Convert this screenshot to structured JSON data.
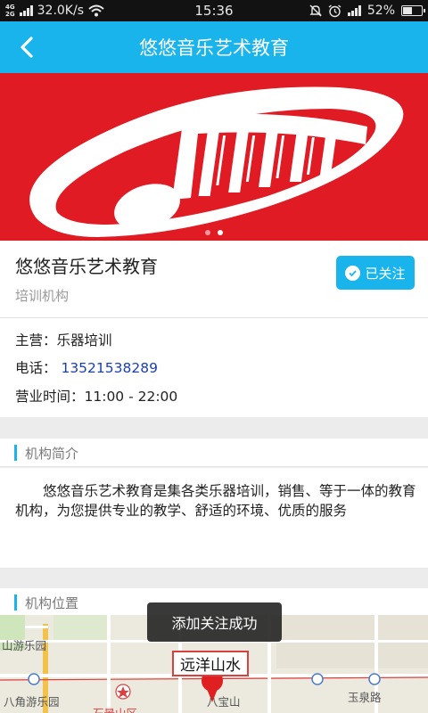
{
  "status_bar": {
    "network_top": "4G",
    "network_bottom": "2G",
    "speed": "32.0K/s",
    "time": "15:36",
    "battery_percent": "52%",
    "battery_level": 0.52,
    "icons": [
      "signal-icon",
      "wifi-icon",
      "mute-icon",
      "alarm-icon",
      "signal-icon",
      "battery-icon"
    ]
  },
  "app_bar": {
    "title": "悠悠音乐艺术教育",
    "back_icon": "back-arrow-icon"
  },
  "banner": {
    "slide_count": 2,
    "active_slide": 2,
    "background_color": "#e01b24"
  },
  "header": {
    "name": "悠悠音乐艺术教育",
    "category": "培训机构",
    "follow_label": "已关注"
  },
  "info": {
    "main_business": "主营：乐器培训",
    "phone_label": "电话：",
    "phone": "13521538289",
    "hours": "营业时间：11:00 - 22:00"
  },
  "intro": {
    "title": "机构简介",
    "text": "悠悠音乐艺术教育是集各类乐器培训，销售、等于一体的教育机构，为您提供专业的教学、舒适的环境、优质的服务"
  },
  "location": {
    "title": "机构位置",
    "marker_label": "远洋山水",
    "map_labels": [
      "山游乐园",
      "八角游乐园",
      "石景山区",
      "八宝山",
      "玉泉路"
    ]
  },
  "toast": {
    "message": "添加关注成功"
  },
  "colors": {
    "accent": "#1ab4ec",
    "banner_red": "#e01b24",
    "phone_link": "#1a3fb0"
  }
}
